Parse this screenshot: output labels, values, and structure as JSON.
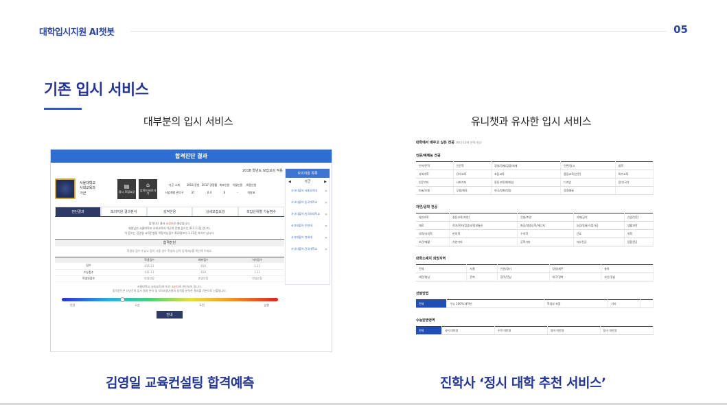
{
  "header": {
    "brand": "대학입시지원 AI챗봇",
    "page_number": "05"
  },
  "section_title": "기존 입시 서비스",
  "left": {
    "subhead": "대부분의 입시 서비스",
    "caption": "김영일 교육컨설팅 합격예측",
    "screen": {
      "title": "합격진단 결과",
      "year_label": "2018 학년도 모집요강 적용",
      "university": "서울대학교",
      "dept": "사회교육과",
      "gun": "가군",
      "btn1": "정시 모집요강",
      "btn2": "입학처 바로가기",
      "stats_headers": [
        "다군 소계",
        "2018 정원",
        "2017 경쟁률",
        "최초인원",
        "이월인원",
        "최종인원"
      ],
      "stats_values": [
        "사범계열 관악구",
        "37",
        "6.4",
        "6",
        "-",
        "미발표"
      ],
      "tabs": [
        "전단결과",
        "모의지원 결과분석",
        "성적반응",
        "상세모집요강",
        "모집단위별 가능점수"
      ],
      "text1": "합격진단 결과 ",
      "text1_em": "소신",
      "text1_tail": "으로 예상됩니다.",
      "text2": "회원님은 서울대학교 사회교육과 가군의 전형 점수는 411.11점 입니다.",
      "text3": "이 점수는 김영일 교육컨설팅 적정가능점수 410점보다 1.11점 차이가 납니다.",
      "band": "합격진단",
      "note": "학생부 점수가 낮고 점이 나올 경우 학생부 성적 입력여부를 확인해 주세요.",
      "table": {
        "headers": [
          "",
          "학생점수",
          "예측점수",
          "차이점수"
        ],
        "rows": [
          [
            "점수",
            "411.11",
            "410",
            "1.11"
          ],
          [
            "수능점수",
            "411.11",
            "410",
            "1.11"
          ],
          [
            "학생부점수",
            "반영안함",
            "반영안함",
            "반영안함"
          ]
        ]
      },
      "foot1": "서울대학교 사회교육과(가군) ",
      "foot1_em": "소신",
      "foot1_tail": "으로 판단되어 집니다.",
      "foot2": "합격진단은 다년간의 입시 결과 분석 및 모의지원자들의 성적을 분석한 결과를 기본으로 산출됩니다.",
      "scale": [
        "안정",
        "소신",
        "도전",
        "상향"
      ],
      "scale_position": 0.27,
      "guide_button": "안내",
      "side": {
        "head": "모의지원 목록",
        "nav": "가군",
        "items": [
          "가나다불어 서울교육대",
          "가나다불어 동국대학교",
          "가나다불어 한국외대학교",
          "사가대불어 인천대",
          "사가대불어 연세대",
          "가나다불어 건국대학교"
        ]
      }
    }
  },
  "right": {
    "subhead": "유니챗과 유사한 입시 서비스",
    "caption": "진학사 ‘정시 대학 추천 서비스’",
    "screen": {
      "top": "대학에서 배우고 싶은 전공",
      "top_note": "(최대 10개 선택가능)",
      "sec1": "인문/예체능 전공",
      "grid1": [
        [
          "언어/문학",
          "인문학",
          "경영/경제/금융/회계",
          "언론/광고",
          "법학"
        ],
        [
          "사회과학",
          "유아교육",
          "초등교육",
          "중등교육(인문)",
          "특수교육"
        ],
        [
          "인문기타",
          "사회기타",
          "중등교육(예체능)",
          "디자인",
          "음악/국악"
        ],
        [
          "미술/조형",
          "무용/체육",
          "연극/영화/방송",
          "응용예술",
          ""
        ]
      ],
      "sec2": "자연/공학 전공",
      "grid2": [
        [
          "자연과학",
          "중등교육(자연)",
          "건설/조경",
          "기계/금속",
          "산업/안전"
        ],
        [
          "재료",
          "전기/전자/컴퓨터/정보통신",
          "화공/생명공학/에너지",
          "농림/동물/식품가공",
          "생활과학"
        ],
        [
          "의학/치의학",
          "한의학",
          "수의학",
          "간호",
          "약학"
        ],
        [
          "보건/재활",
          "자연기타",
          "공학기타",
          "자유전공",
          "융합전공"
        ]
      ],
      "sec3": "대학소재지 희망지역",
      "grid3": [
        [
          "전체",
          "서울",
          "인천/경기",
          "강원/제주",
          "충북"
        ],
        [
          "대전/충남",
          "전북",
          "광주/전남",
          "대구/경북",
          "부산/경남"
        ]
      ],
      "sec4": "선발방법",
      "grid4": [
        [
          "전체",
          "수능 100% 대학만",
          "학생부 포함",
          "기타",
          ""
        ]
      ],
      "sec5": "수능반영영역",
      "grid5": [
        [
          "전체",
          "국어 미반영",
          "수학 미반영",
          "영어 미반영",
          "탐구 미반영"
        ]
      ]
    }
  }
}
